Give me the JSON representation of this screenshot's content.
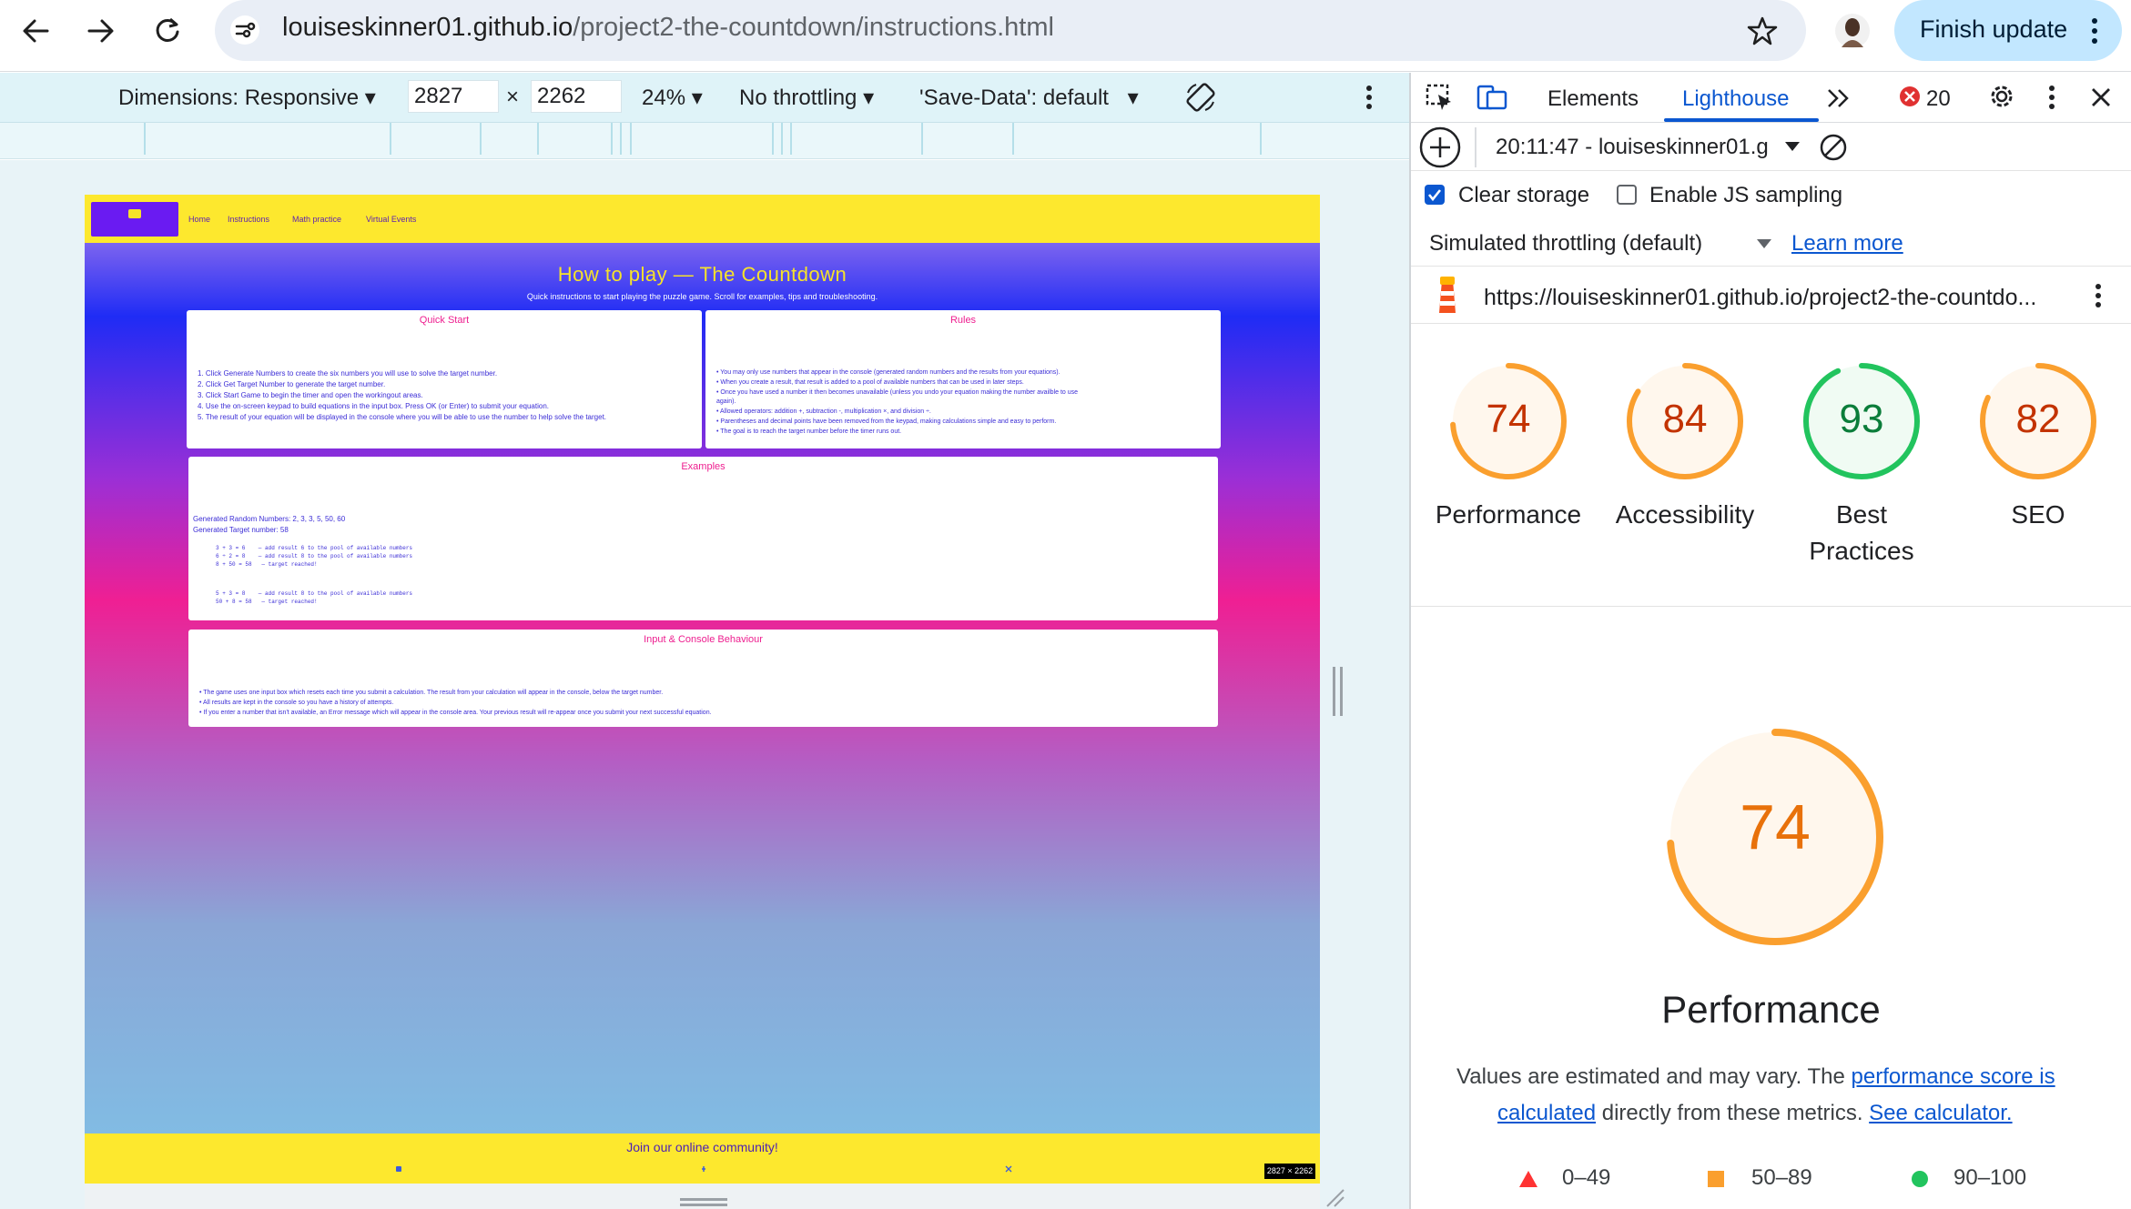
{
  "browser": {
    "url_domain": "louiseskinner01.github.io",
    "url_path": "/project2-the-countdown/instructions.html",
    "finish_update": "Finish update"
  },
  "emulation": {
    "dimensions": "Dimensions: Responsive",
    "width": "2827",
    "times": "×",
    "height": "2262",
    "zoom": "24%",
    "throttling": "No throttling",
    "save_data": "'Save-Data': default"
  },
  "site": {
    "nav": [
      "Home",
      "Instructions",
      "Math practice",
      "Virtual Events"
    ],
    "title": "How to play — The Countdown",
    "subtitle": "Quick instructions to start playing the puzzle game. Scroll for examples, tips and troubleshooting.",
    "quick_start": {
      "title": "Quick Start",
      "lines": [
        "1. Click Generate Numbers to create the six numbers you will use to solve the target number.",
        "2. Click Get Target Number to generate the target number.",
        "3. Click Start Game to begin the timer and open the workingout areas.",
        "4. Use the on-screen keypad to build equations in the input box. Press OK (or Enter) to submit your equation.",
        "5. The result of your equation will be displayed in the console where you will be able to use the number to help solve the target."
      ]
    },
    "rules": {
      "title": "Rules",
      "lines": [
        "• You may only use numbers that appear in the console (generated random numbers and the results from your equations).",
        "• When you create a result, that result is added to a pool of available numbers that can be used in later steps.",
        "• Once you have used a number it then becomes unavailable (unless you undo your equation making the number availble to use",
        "  again).",
        "• Allowed operators: addition +, subtraction -, multiplication ×, and division ÷.",
        "• Parentheses and decimal points have been removed from the keypad, making calculations simple and easy to perform.",
        "• The goal is to reach the target number before the timer runs out."
      ]
    },
    "examples": {
      "title": "Examples",
      "generated_label": "Generated Random Numbers: 2, 3, 3, 5, 50, 60",
      "target_label": "Generated Target number: 58",
      "code_a": "3 + 3 = 6    — add result 6 to the pool of available numbers\n6 ÷ 2 = 8    — add result 8 to the pool of available numbers\n8 + 50 = 58   — target reached!",
      "code_b": "5 + 3 = 8    — add result 8 to the pool of available numbers\n50 + 8 = 58   — target reached!"
    },
    "input_console": {
      "title": "Input & Console Behaviour",
      "lines": [
        "• The game uses one input box which resets each time you submit a calculation. The result from your calculation will appear in the console, below the target number.",
        "• All results are kept in the console so you have a history of attempts.",
        "• If you enter a number that isn't available, an Error message which will appear in the console area. Your previous result will re-appear once you submit your next successful equation."
      ]
    },
    "footer_title": "Join our online community!",
    "dimension_badge": "2827 × 2262"
  },
  "devtools": {
    "tabs": [
      "Elements",
      "Lighthouse"
    ],
    "error_count": "20",
    "report_time": "20:11:47 - louiseskinner01.g",
    "clear_storage": "Clear storage",
    "enable_js_sampling": "Enable JS sampling",
    "simulated_throttling": "Simulated throttling (default)",
    "learn_more": "Learn more",
    "audited_url": "https://louiseskinner01.github.io/project2-the-countdo...",
    "scores": [
      {
        "label": "Performance",
        "value": 74,
        "color": "#fa9f2e"
      },
      {
        "label": "Accessibility",
        "value": 84,
        "color": "#fa9f2e"
      },
      {
        "label": "Best Practices",
        "value": 93,
        "color": "#22c45e"
      },
      {
        "label": "SEO",
        "value": 82,
        "color": "#fa9f2e"
      }
    ],
    "score_labels": {
      "performance": "Performance",
      "accessibility": "Accessibility",
      "best": "Best",
      "practices": "Practices",
      "seo": "SEO"
    },
    "big_score": "74",
    "big_title": "Performance",
    "desc_text1": "Values are estimated and may vary. The ",
    "desc_link1a": "performance score is",
    "desc_link1b": "calculated",
    "desc_text2": " directly from these metrics. ",
    "desc_link2": "See calculator.",
    "legend": [
      "0–49",
      "50–89",
      "90–100"
    ]
  },
  "colors": {
    "accent": "#0b57d0",
    "orange": "#fa9f2e",
    "green": "#22c45e",
    "red": "#ff3333"
  }
}
